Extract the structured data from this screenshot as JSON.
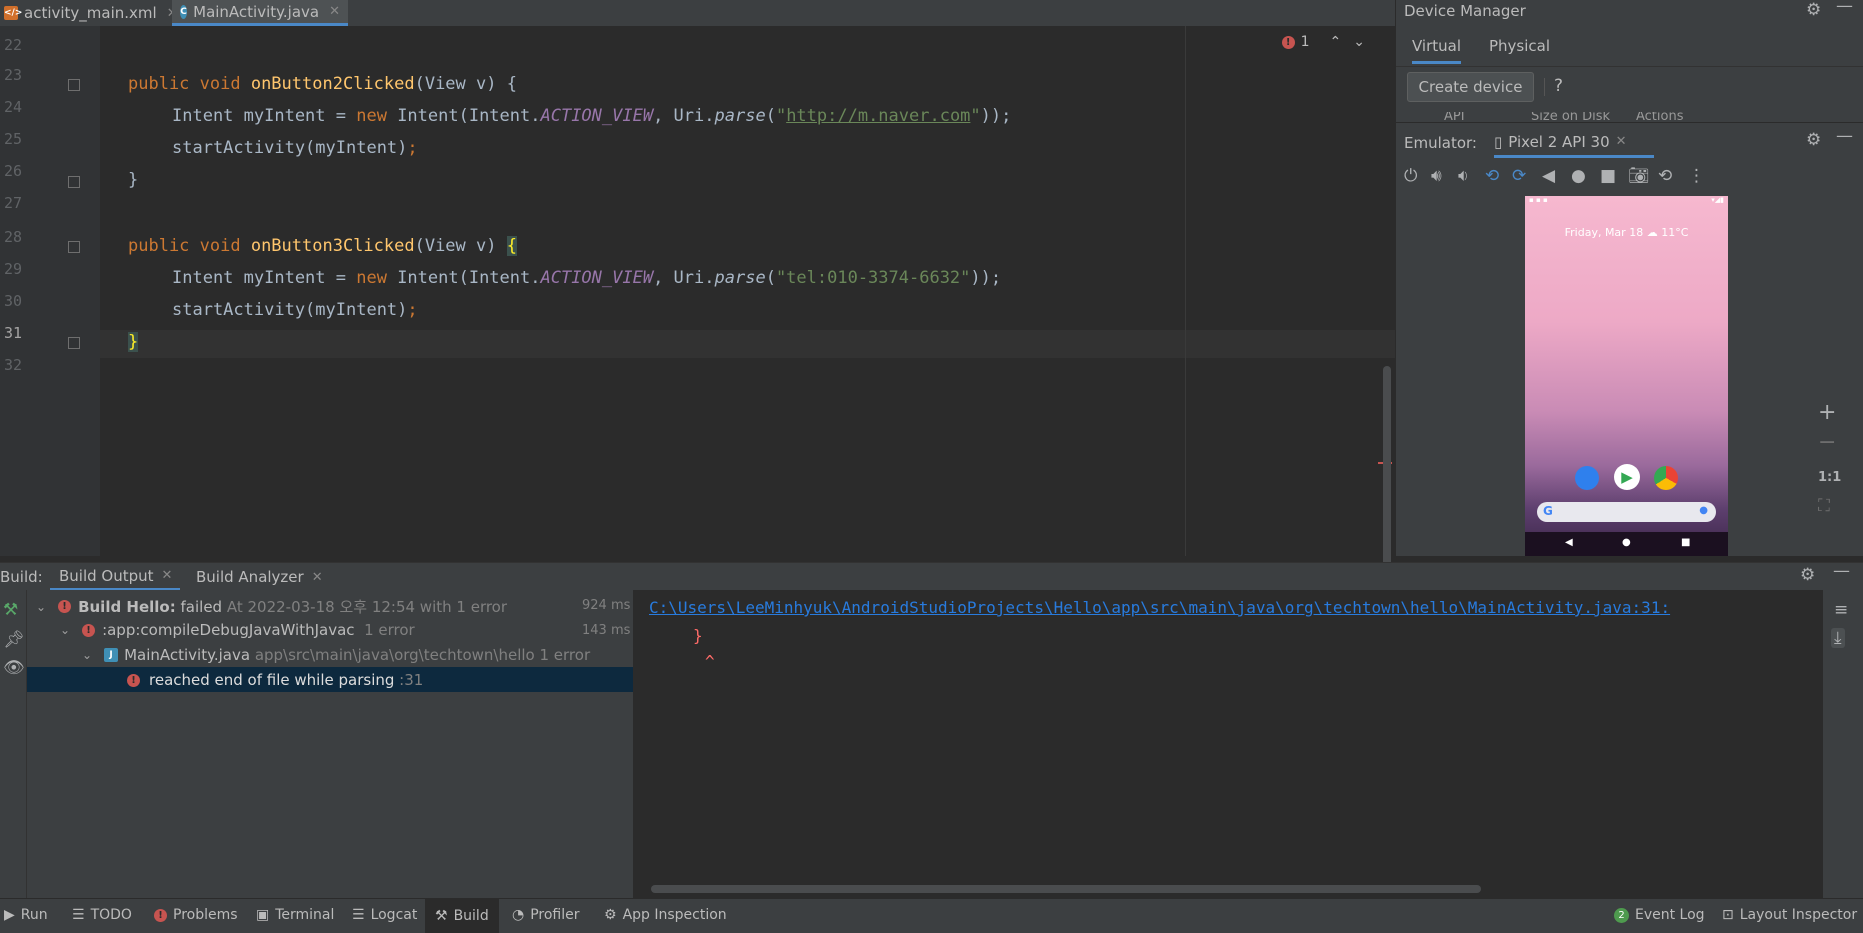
{
  "tabs": [
    {
      "label": "activity_main.xml",
      "active": false
    },
    {
      "label": "MainActivity.java",
      "active": true
    }
  ],
  "editor": {
    "line_numbers": [
      "22",
      "23",
      "24",
      "25",
      "26",
      "27",
      "28",
      "29",
      "30",
      "31",
      "32"
    ],
    "error_count": "1",
    "lines": {
      "l1_kw": "public void ",
      "l1_fn": "onButton2Clicked",
      "l1_rest": "(View v) {",
      "l2_a": "Intent myIntent = ",
      "l2_kw": "new ",
      "l2_b": "Intent(Intent.",
      "l2_const": "ACTION_VIEW",
      "l2_c": ", Uri.",
      "l2_parse": "parse",
      "l2_d": "(",
      "l2_q1": "\"",
      "l2_url": "http://m.naver.com",
      "l2_q2": "\"",
      "l2_e": "));",
      "l3_a": "startActivity(myIntent)",
      "l3_semi": ";",
      "l4": "}",
      "l6_kw": "public void ",
      "l6_fn": "onButton3Clicked",
      "l6_rest": "(View v) ",
      "l6_brace": "{",
      "l7_a": "Intent myIntent = ",
      "l7_kw": "new ",
      "l7_b": "Intent(Intent.",
      "l7_const": "ACTION_VIEW",
      "l7_c": ", Uri.",
      "l7_parse": "parse",
      "l7_d": "(",
      "l7_str": "\"tel:010-3374-6632\"",
      "l7_e": "));",
      "l8_a": "startActivity(myIntent)",
      "l8_semi": ";",
      "l9": "}"
    }
  },
  "device_manager": {
    "title": "Device Manager",
    "tabs": [
      "Virtual",
      "Physical"
    ],
    "create_device": "Create device",
    "help": "?",
    "partial_columns": [
      "API",
      "Size on Disk",
      "Actions"
    ]
  },
  "emulator": {
    "label": "Emulator:",
    "device_tab": "Pixel 2 API 30",
    "lock_date": "Friday, Mar 18",
    "lock_weather": "11°C",
    "zoom_ratio": "1:1"
  },
  "build": {
    "label": "Build:",
    "tabs": [
      "Build Output",
      "Build Analyzer"
    ],
    "tree": [
      {
        "title": "Build Hello:",
        "status": "failed",
        "detail": "At 2022-03-18 오후 12:54 with 1 error",
        "time": "924 ms"
      },
      {
        "title": ":app:compileDebugJavaWithJavac",
        "detail": "1 error",
        "time": "143 ms"
      },
      {
        "title": "MainActivity.java",
        "detail": "app\\src\\main\\java\\org\\techtown\\hello 1 error"
      },
      {
        "title": "reached end of file while parsing",
        "detail": ":31"
      }
    ],
    "output_link": "C:\\Users\\LeeMinhyuk\\AndroidStudioProjects\\Hello\\app\\src\\main\\java\\org\\techtown\\hello\\MainActivity.java:31:",
    "output_line2": "}",
    "output_line3": "^"
  },
  "statusbar": {
    "left": [
      "Run",
      "TODO",
      "Problems",
      "Terminal",
      "Logcat",
      "Build",
      "Profiler",
      "App Inspection"
    ],
    "right": [
      "Event Log",
      "Layout Inspector"
    ],
    "event_count": "2"
  },
  "colors": {
    "accent": "#4a88c7",
    "error": "#c75450",
    "link": "#287bde"
  }
}
